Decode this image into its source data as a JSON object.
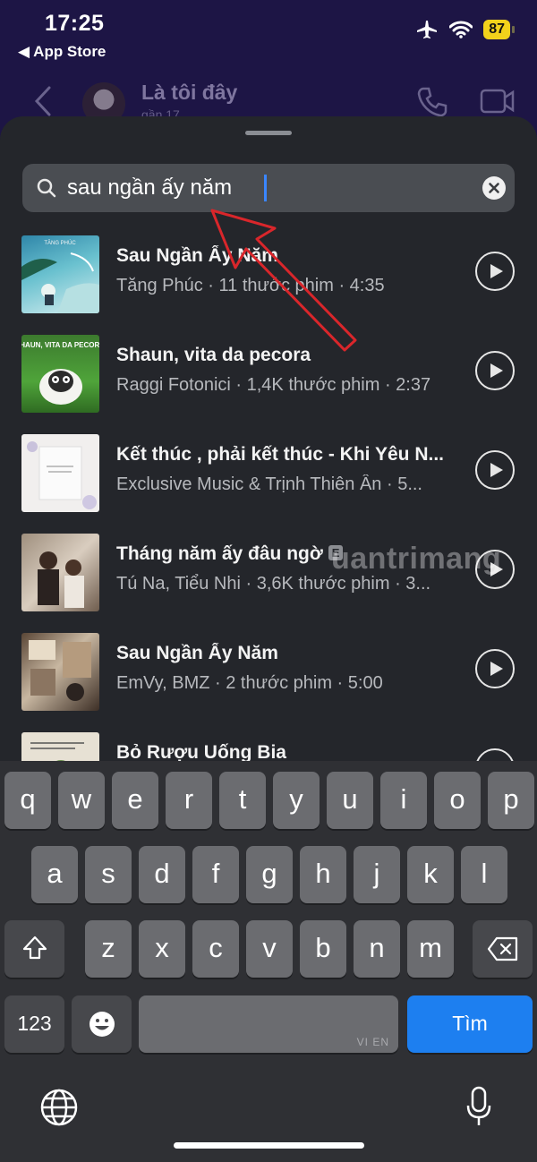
{
  "status_bar": {
    "time": "17:25",
    "back_app": "◀ App Store",
    "battery": "87"
  },
  "chat_header": {
    "name": "Là tôi đây",
    "subtitle": "gần 17"
  },
  "search": {
    "query": "sau ngần ấy năm",
    "placeholder": ""
  },
  "results": [
    {
      "title": "Sau Ngần Ấy Năm",
      "meta": "Tăng Phúc · 11 thước phim · 4:35",
      "explicit": false
    },
    {
      "title": "Shaun, vita da pecora",
      "meta": "Raggi Fotonici · 1,4K thước phim · 2:37",
      "explicit": false
    },
    {
      "title": "Kết thúc , phải kết thúc - Khi Yêu N...",
      "meta": "Exclusive Music & Trịnh Thiên Ân · 5...",
      "explicit": false
    },
    {
      "title": "Tháng năm ấy đâu ngờ",
      "meta": "Tú Na, Tiểu Nhi · 3,6K thước phim · 3...",
      "explicit": true,
      "explicit_label": "E"
    },
    {
      "title": "Sau Ngần Ấy Năm",
      "meta": "EmVy, BMZ · 2 thước phim · 5:00",
      "explicit": false
    },
    {
      "title": "Bỏ Rượu Uống Bia",
      "meta": "",
      "explicit": false
    }
  ],
  "cover_text": {
    "c1_artist": "TĂNG PHÚC",
    "c2_title": "SHAUN, VITA DA PECORA"
  },
  "watermark": "uantrimang",
  "keyboard": {
    "row1": [
      "q",
      "w",
      "e",
      "r",
      "t",
      "y",
      "u",
      "i",
      "o",
      "p"
    ],
    "row2": [
      "a",
      "s",
      "d",
      "f",
      "g",
      "h",
      "j",
      "k",
      "l"
    ],
    "row3": [
      "z",
      "x",
      "c",
      "v",
      "b",
      "n",
      "m"
    ],
    "numbers_key": "123",
    "space_hint": "VI EN",
    "search_key": "Tìm"
  },
  "colors": {
    "sheet_bg": "#24262b",
    "accent_blue": "#1d7ff0",
    "arrow_red": "#d9262b"
  }
}
